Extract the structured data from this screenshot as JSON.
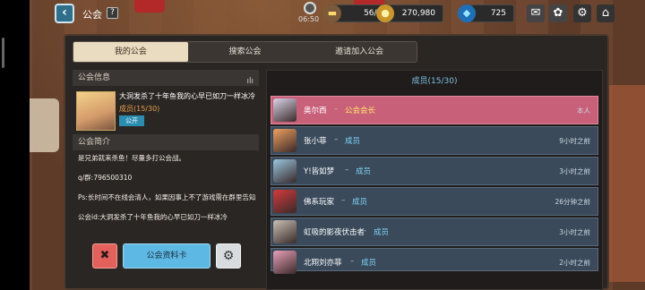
{
  "topbar": {
    "back_icon": "back-arrow-icon",
    "title": "公会",
    "help_label": "?",
    "clock_time": "06:50",
    "stamina": "56/76",
    "gold": "270,980",
    "gems": "725",
    "icons": [
      "mail-icon",
      "gear-settings-icon",
      "settings-icon",
      "home-icon"
    ]
  },
  "tabs": [
    {
      "label": "我的公会",
      "active": true
    },
    {
      "label": "搜索公会",
      "active": false
    },
    {
      "label": "邀请加入公会",
      "active": false
    }
  ],
  "guild_info": {
    "header": "公会信息",
    "description": "大洞发杀了十年鱼我的心早已如刀一样冰冷",
    "members": "成员(15/30)",
    "visibility": "公开"
  },
  "guild_intro": {
    "header": "公会简介",
    "lines": [
      "是兄弟就来杀鱼！尽量多打公会战。",
      "q/群:796500310",
      "Ps:长时间不在线会清人，如果因事上不了游戏需在群里告知",
      "公会id:大洞发杀了十年鱼我的心早已如刀一样冰冷"
    ]
  },
  "actions": {
    "leave_icon": "shield-x-icon",
    "profile_card_label": "公会资料卡",
    "settings_icon": "gear-icon"
  },
  "members_panel": {
    "header": "成员(15/30)",
    "dash": "–",
    "members": [
      {
        "name": "奥尔西",
        "role": "公会会长",
        "time": "本人",
        "self": true,
        "color": "#d9d4e8"
      },
      {
        "name": "张小菲",
        "role": "成员",
        "time": "9小时之前",
        "self": false,
        "color": "#f0a060"
      },
      {
        "name": "Y!皆如梦",
        "role": "成员",
        "time": "3小时之前",
        "self": false,
        "color": "#9ac7e0"
      },
      {
        "name": "佛系玩家",
        "role": "成员",
        "time": "26分钟之前",
        "self": false,
        "color": "#d43a3a"
      },
      {
        "name": "虹吸的影夜伏击者",
        "role": "成员",
        "time": "3小时之前",
        "self": false,
        "color": "#c9c0b4"
      },
      {
        "name": "北翔刘亦菲",
        "role": "成员",
        "time": "2小时之前",
        "self": false,
        "color": "#e8a0b8"
      }
    ]
  }
}
